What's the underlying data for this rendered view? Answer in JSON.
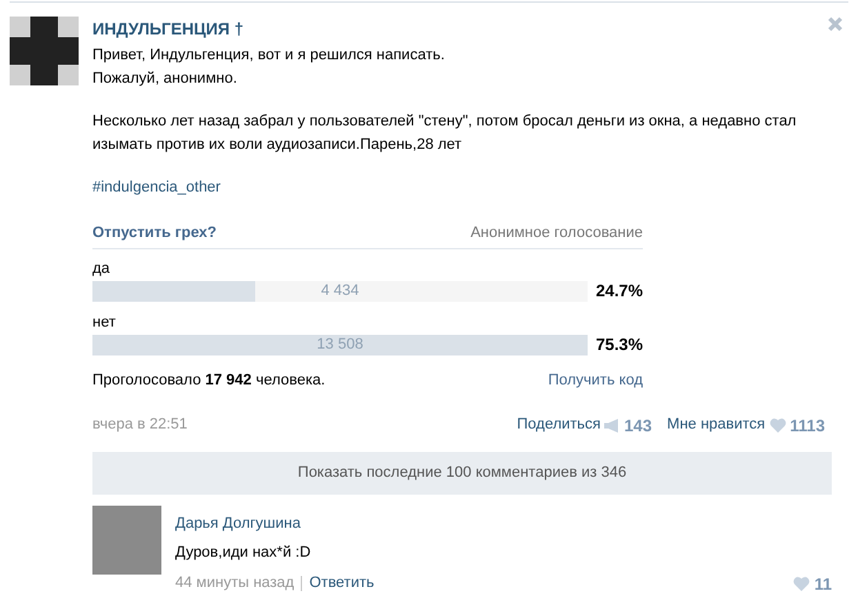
{
  "post": {
    "author": "ИНДУЛЬГЕНЦИЯ †",
    "paragraphs": [
      "Привет, Индульгенция, вот и я решился написать.\nПожалуй, анонимно.",
      "Несколько лет назад забрал у пользователей \"стену\", потом бросал деньги из окна, а недавно стал изымать против их воли аудиозаписи.Парень,28 лет"
    ],
    "hashtag": "#indulgencia_other"
  },
  "poll": {
    "question": "Отпустить грех?",
    "type": "Анонимное голосование",
    "options": [
      {
        "label": "да",
        "count": "4 434",
        "percent": "24.7%",
        "level": 0.33
      },
      {
        "label": "нет",
        "count": "13 508",
        "percent": "75.3%",
        "level": 1
      }
    ],
    "total": "Проголосовало **17 942** человека.",
    "get_code": "Получить код"
  },
  "footer": {
    "time": "вчера в 22:51",
    "share": "Поделиться",
    "share_count": "143",
    "like": "Мне нравится",
    "like_count": "1113"
  },
  "show_comments": "Показать последние 100 комментариев из 346",
  "comments": [
    {
      "author": "Дарья Долгушина",
      "text": "Дуров,иди нах*й :D",
      "time": "44 минуты назад",
      "reply": "Ответить",
      "likes": "11"
    }
  ]
}
